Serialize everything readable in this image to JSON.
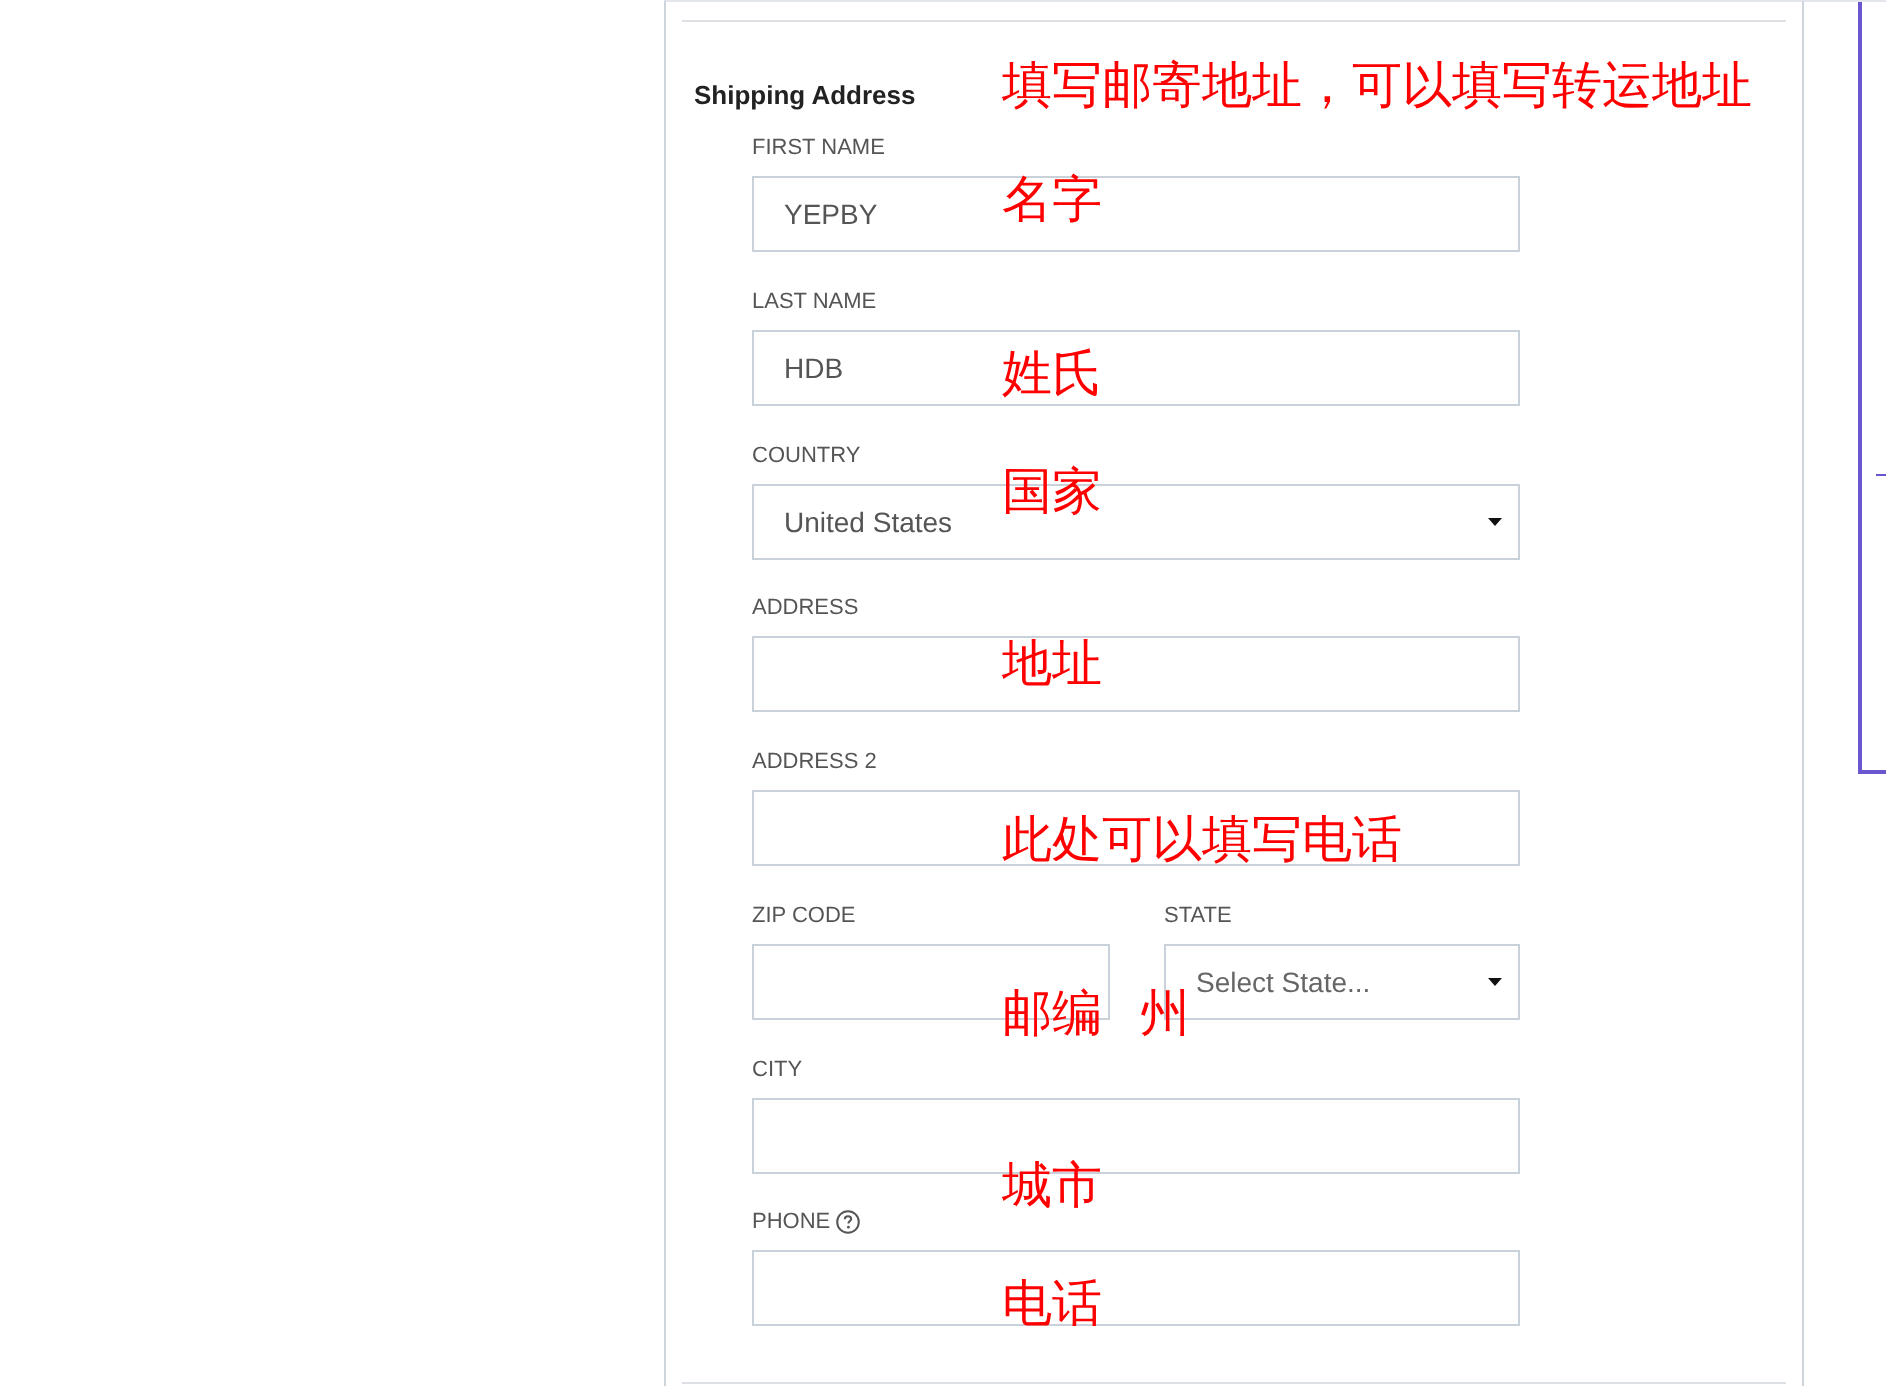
{
  "shipping_address": {
    "title": "Shipping Address",
    "note": "填写邮寄地址，可以填写转运地址",
    "rows": [
      [
        {
          "kind": "text",
          "label": "FIRST NAME",
          "value": "YEPBY",
          "note": "名字"
        }
      ],
      [
        {
          "kind": "text",
          "label": "LAST NAME",
          "value": "HDB",
          "note": "姓氏"
        }
      ],
      [
        {
          "kind": "select",
          "label": "COUNTRY",
          "value": "United States",
          "note": "国家"
        }
      ],
      [
        {
          "kind": "text",
          "label": "ADDRESS",
          "note": "地址"
        }
      ],
      [
        {
          "kind": "text",
          "label": "ADDRESS 2",
          "note": "此处可以填写电话"
        }
      ],
      [
        {
          "kind": "text",
          "label": "ZIP CODE",
          "note": "邮编"
        },
        {
          "kind": "select",
          "label": "STATE",
          "placeholder": "Select State...",
          "note": "州"
        }
      ],
      [
        {
          "kind": "text",
          "label": "CITY",
          "note": "城市"
        }
      ],
      [
        {
          "kind": "text",
          "label": "PHONE",
          "help": true,
          "note": "电话"
        }
      ]
    ]
  }
}
